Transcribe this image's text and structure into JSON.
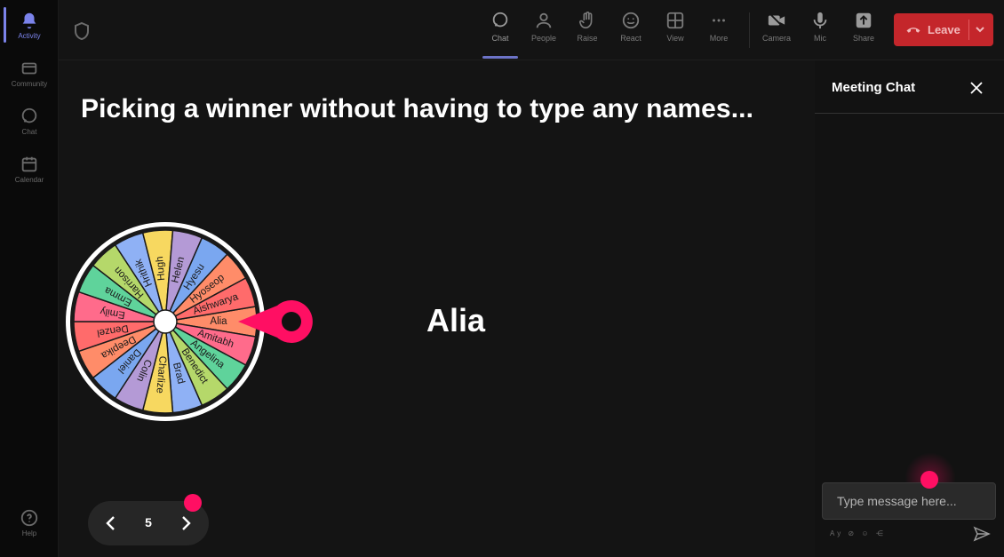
{
  "rail": {
    "items": [
      {
        "label": "Activity"
      },
      {
        "label": "Community"
      },
      {
        "label": "Chat"
      },
      {
        "label": "Calendar"
      },
      {
        "label": "Help"
      }
    ]
  },
  "topbar": {
    "items": [
      {
        "label": "Chat",
        "icon": "chat-bubble-icon"
      },
      {
        "label": "People",
        "icon": "people-icon"
      },
      {
        "label": "Raise",
        "icon": "raise-hand-icon"
      },
      {
        "label": "React",
        "icon": "smiley-icon"
      },
      {
        "label": "View",
        "icon": "grid-icon"
      },
      {
        "label": "More",
        "icon": "more-dots-icon"
      },
      {
        "label": "Camera",
        "icon": "camera-icon"
      },
      {
        "label": "Mic",
        "icon": "mic-icon"
      },
      {
        "label": "Share",
        "icon": "share-icon"
      }
    ],
    "leave_label": "Leave"
  },
  "stage": {
    "headline": "Picking a winner without having to type any names...",
    "winner": "Alia",
    "pager_number": "5",
    "wheel_names": [
      "Alia",
      "Amitabh",
      "Angelina",
      "Benedict",
      "Brad",
      "Charlize",
      "Colin",
      "Daniel",
      "Deepika",
      "Denzel",
      "Emily",
      "Emma",
      "Harrison",
      "Hrithik",
      "Hugh",
      "Helen",
      "Hyesu",
      "Hyoseop",
      "Aishwarya"
    ],
    "wheel_colors": [
      "#ff8c69",
      "#ff6b8b",
      "#5fd39b",
      "#b5d86a",
      "#8fb1f5",
      "#f7d860",
      "#b49ad6",
      "#7aa7f0",
      "#ff8c69",
      "#ff6b6b",
      "#ff6b8b",
      "#5fd39b",
      "#b5d86a",
      "#8fb1f5",
      "#f7d860",
      "#b49ad6",
      "#7aa7f0",
      "#ff8c69",
      "#ff6b6b"
    ]
  },
  "chat": {
    "title": "Meeting Chat",
    "input_placeholder": "Type message here...",
    "tools": "Ay ⊘ ☺ ⋲"
  },
  "colors": {
    "accent": "#ff0f63",
    "leave": "#c4262b",
    "teams_purple": "#7b83eb"
  }
}
